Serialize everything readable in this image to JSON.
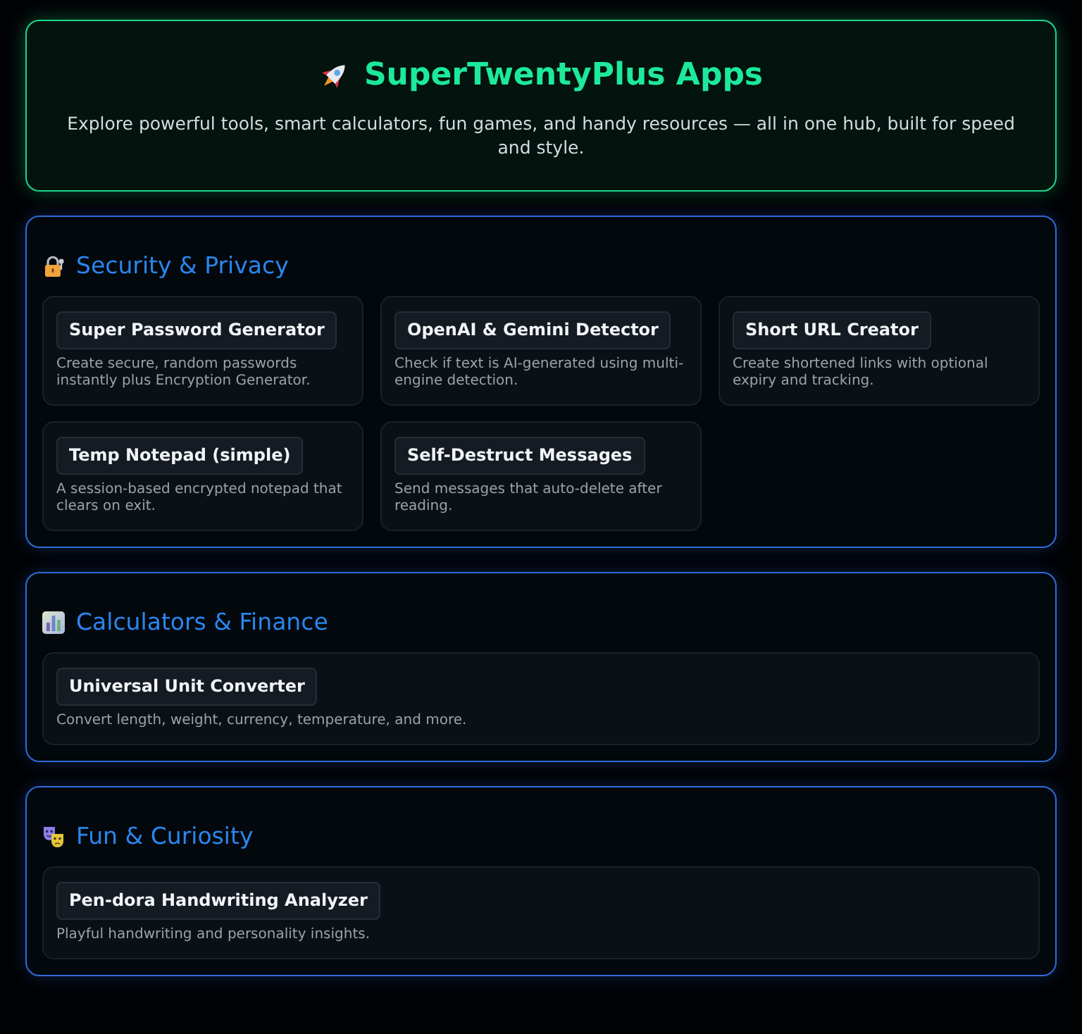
{
  "header": {
    "title": "SuperTwentyPlus Apps",
    "subtitle": "Explore powerful tools, smart calculators, fun games, and handy resources — all in one hub, built for speed and style."
  },
  "sections": [
    {
      "title": "Security & Privacy",
      "tools": [
        {
          "name": "Super Password Generator",
          "description": "Create secure, random passwords instantly plus Encryption Generator."
        },
        {
          "name": "OpenAI & Gemini Detector",
          "description": "Check if text is AI-generated using multi-engine detection."
        },
        {
          "name": "Short URL Creator",
          "description": "Create shortened links with optional expiry and tracking."
        },
        {
          "name": "Temp Notepad (simple)",
          "description": "A session-based encrypted notepad that clears on exit."
        },
        {
          "name": "Self-Destruct Messages",
          "description": "Send messages that auto-delete after reading."
        }
      ]
    },
    {
      "title": "Calculators & Finance",
      "tools": [
        {
          "name": "Universal Unit Converter",
          "description": "Convert length, weight, currency, temperature, and more."
        }
      ]
    },
    {
      "title": "Fun & Curiosity",
      "tools": [
        {
          "name": "Pen-dora Handwriting Analyzer",
          "description": "Playful handwriting and personality insights."
        }
      ]
    }
  ]
}
